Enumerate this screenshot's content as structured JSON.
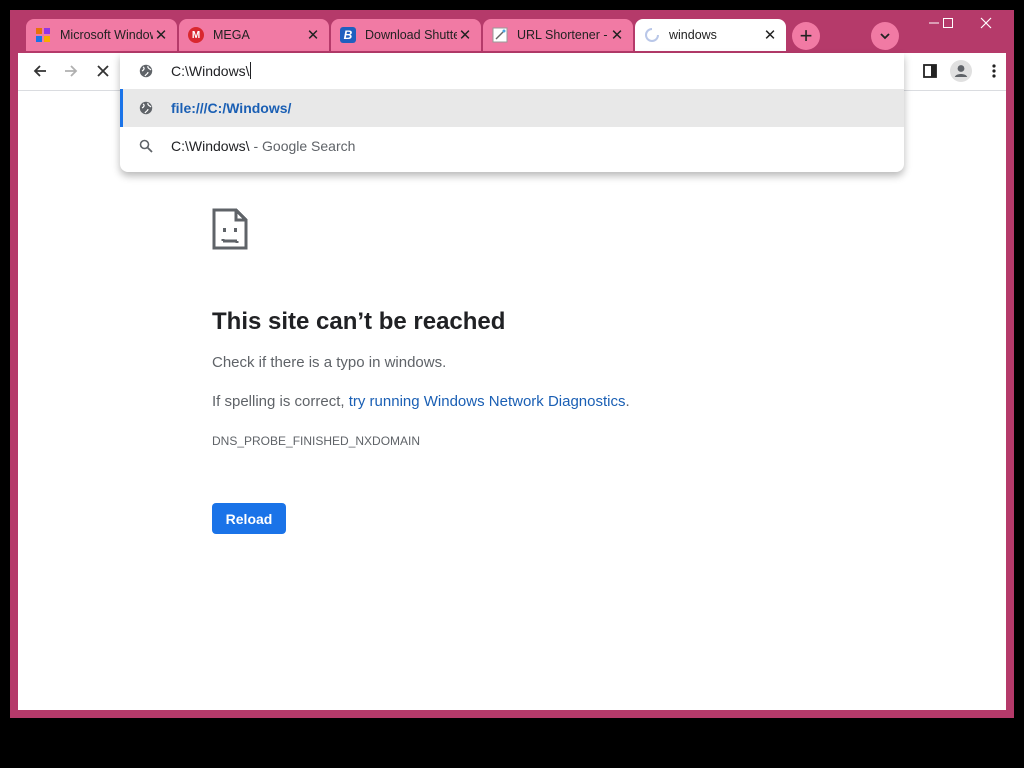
{
  "tabs": [
    {
      "title": "Microsoft Windows"
    },
    {
      "title": "MEGA"
    },
    {
      "title": "Download Shutter"
    },
    {
      "title": "URL Shortener - "
    },
    {
      "title": "windows"
    }
  ],
  "favicon_text": {
    "mega": "M",
    "download": "B"
  },
  "toolbar": {
    "address_value": "C:\\Windows\\"
  },
  "omnibox": {
    "suggestion_url": "file:///C:/Windows/",
    "search_query": "C:\\Windows\\",
    "search_suffix": " - Google Search"
  },
  "error_page": {
    "title": "This site can’t be reached",
    "line1": "Check if there is a typo in windows.",
    "line2_prefix": "If spelling is correct, ",
    "line2_link": "try running Windows Network Diagnostics",
    "line2_suffix": ".",
    "error_code": "DNS_PROBE_FINISHED_NXDOMAIN",
    "reload_label": "Reload"
  },
  "colors": {
    "frame": "#b53a6a",
    "inactive_tab": "#f17aa4",
    "link": "#1a5fb4",
    "reload_button": "#1a73e8"
  },
  "icons": [
    "google-cloud-icon",
    "mega-icon",
    "b-icon",
    "url-icon",
    "loading-spinner-icon",
    "new-tab-icon",
    "tab-search-icon",
    "minimize-icon",
    "maximize-icon",
    "close-window-icon",
    "back-icon",
    "forward-icon",
    "stop-icon",
    "globe-icon",
    "search-icon",
    "side-panel-icon",
    "profile-icon",
    "menu-icon",
    "sad-page-icon"
  ]
}
